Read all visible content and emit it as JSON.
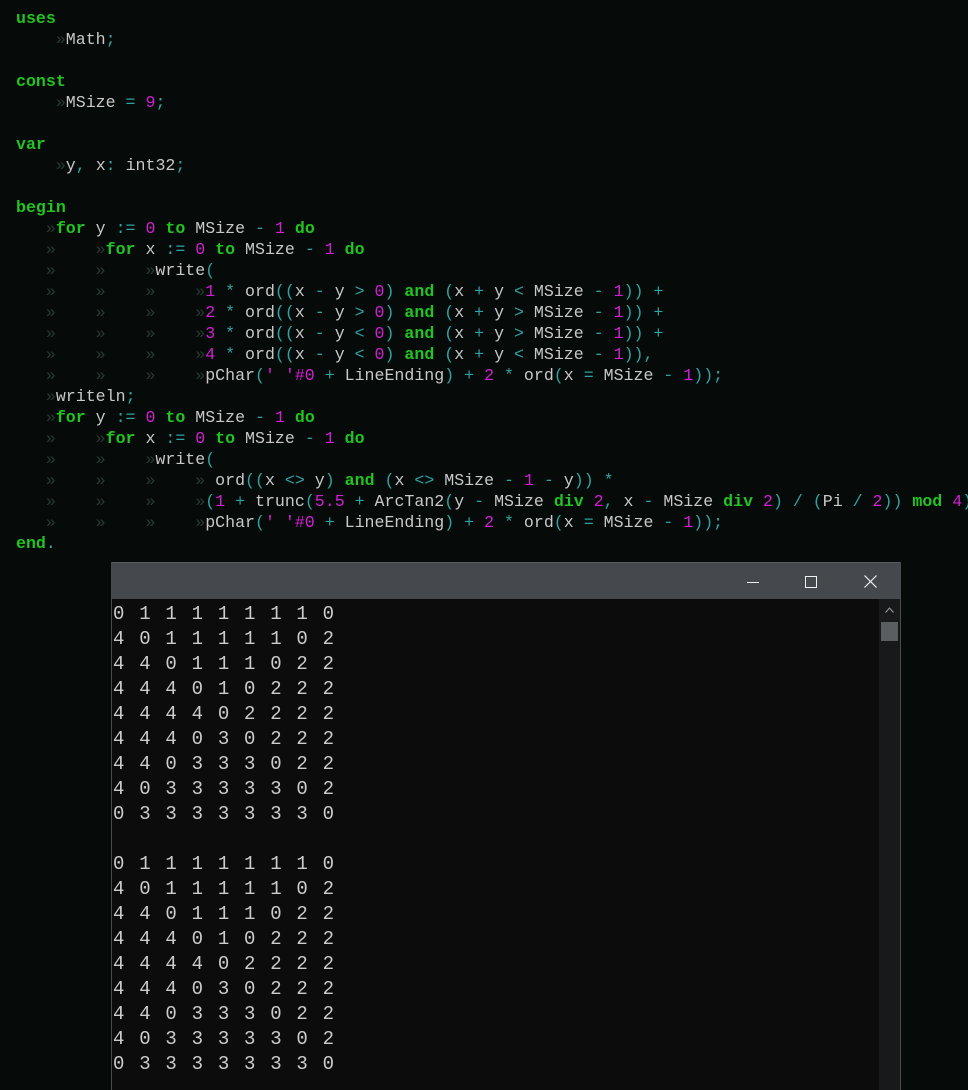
{
  "editor": {
    "lines": [
      [
        [
          "kw",
          "uses"
        ]
      ],
      [
        [
          "ws",
          "    »"
        ],
        [
          "id",
          "Math"
        ],
        [
          "op",
          ";"
        ]
      ],
      [],
      [
        [
          "kw",
          "const"
        ]
      ],
      [
        [
          "ws",
          "    »"
        ],
        [
          "id",
          "MSize"
        ],
        [
          "op",
          " = "
        ],
        [
          "num",
          "9"
        ],
        [
          "op",
          ";"
        ]
      ],
      [],
      [
        [
          "kw",
          "var"
        ]
      ],
      [
        [
          "ws",
          "    »"
        ],
        [
          "id",
          "y"
        ],
        [
          "op",
          ", "
        ],
        [
          "id",
          "x"
        ],
        [
          "op",
          ": "
        ],
        [
          "id",
          "int32"
        ],
        [
          "op",
          ";"
        ]
      ],
      [],
      [
        [
          "kw",
          "begin"
        ]
      ],
      [
        [
          "ws",
          "   »"
        ],
        [
          "kw",
          "for"
        ],
        [
          "id",
          " y "
        ],
        [
          "op",
          ":="
        ],
        [
          "num",
          " 0 "
        ],
        [
          "kw",
          "to"
        ],
        [
          "id",
          " MSize "
        ],
        [
          "op",
          "-"
        ],
        [
          "num",
          " 1 "
        ],
        [
          "kw",
          "do"
        ]
      ],
      [
        [
          "ws",
          "   »    »"
        ],
        [
          "kw",
          "for"
        ],
        [
          "id",
          " x "
        ],
        [
          "op",
          ":="
        ],
        [
          "num",
          " 0 "
        ],
        [
          "kw",
          "to"
        ],
        [
          "id",
          " MSize "
        ],
        [
          "op",
          "-"
        ],
        [
          "num",
          " 1 "
        ],
        [
          "kw",
          "do"
        ]
      ],
      [
        [
          "ws",
          "   »    »    »"
        ],
        [
          "id",
          "write"
        ],
        [
          "op",
          "("
        ]
      ],
      [
        [
          "ws",
          "   »    »    »    »"
        ],
        [
          "num",
          "1"
        ],
        [
          "op",
          " * "
        ],
        [
          "id",
          "ord"
        ],
        [
          "op",
          "(("
        ],
        [
          "id",
          "x "
        ],
        [
          "op",
          "-"
        ],
        [
          "id",
          " y "
        ],
        [
          "op",
          ">"
        ],
        [
          "num",
          " 0"
        ],
        [
          "op",
          ") "
        ],
        [
          "kw",
          "and"
        ],
        [
          "op",
          " ("
        ],
        [
          "id",
          "x "
        ],
        [
          "op",
          "+"
        ],
        [
          "id",
          " y "
        ],
        [
          "op",
          "<"
        ],
        [
          "id",
          " MSize "
        ],
        [
          "op",
          "-"
        ],
        [
          "num",
          " 1"
        ],
        [
          "op",
          ")) +"
        ]
      ],
      [
        [
          "ws",
          "   »    »    »    »"
        ],
        [
          "num",
          "2"
        ],
        [
          "op",
          " * "
        ],
        [
          "id",
          "ord"
        ],
        [
          "op",
          "(("
        ],
        [
          "id",
          "x "
        ],
        [
          "op",
          "-"
        ],
        [
          "id",
          " y "
        ],
        [
          "op",
          ">"
        ],
        [
          "num",
          " 0"
        ],
        [
          "op",
          ") "
        ],
        [
          "kw",
          "and"
        ],
        [
          "op",
          " ("
        ],
        [
          "id",
          "x "
        ],
        [
          "op",
          "+"
        ],
        [
          "id",
          " y "
        ],
        [
          "op",
          ">"
        ],
        [
          "id",
          " MSize "
        ],
        [
          "op",
          "-"
        ],
        [
          "num",
          " 1"
        ],
        [
          "op",
          ")) +"
        ]
      ],
      [
        [
          "ws",
          "   »    »    »    »"
        ],
        [
          "num",
          "3"
        ],
        [
          "op",
          " * "
        ],
        [
          "id",
          "ord"
        ],
        [
          "op",
          "(("
        ],
        [
          "id",
          "x "
        ],
        [
          "op",
          "-"
        ],
        [
          "id",
          " y "
        ],
        [
          "op",
          "<"
        ],
        [
          "num",
          " 0"
        ],
        [
          "op",
          ") "
        ],
        [
          "kw",
          "and"
        ],
        [
          "op",
          " ("
        ],
        [
          "id",
          "x "
        ],
        [
          "op",
          "+"
        ],
        [
          "id",
          " y "
        ],
        [
          "op",
          ">"
        ],
        [
          "id",
          " MSize "
        ],
        [
          "op",
          "-"
        ],
        [
          "num",
          " 1"
        ],
        [
          "op",
          ")) +"
        ]
      ],
      [
        [
          "ws",
          "   »    »    »    »"
        ],
        [
          "num",
          "4"
        ],
        [
          "op",
          " * "
        ],
        [
          "id",
          "ord"
        ],
        [
          "op",
          "(("
        ],
        [
          "id",
          "x "
        ],
        [
          "op",
          "-"
        ],
        [
          "id",
          " y "
        ],
        [
          "op",
          "<"
        ],
        [
          "num",
          " 0"
        ],
        [
          "op",
          ") "
        ],
        [
          "kw",
          "and"
        ],
        [
          "op",
          " ("
        ],
        [
          "id",
          "x "
        ],
        [
          "op",
          "+"
        ],
        [
          "id",
          " y "
        ],
        [
          "op",
          "<"
        ],
        [
          "id",
          " MSize "
        ],
        [
          "op",
          "-"
        ],
        [
          "num",
          " 1"
        ],
        [
          "op",
          ")),"
        ]
      ],
      [
        [
          "ws",
          "   »    »    »    »"
        ],
        [
          "id",
          "pChar"
        ],
        [
          "op",
          "("
        ],
        [
          "str",
          "' '#0"
        ],
        [
          "op",
          " + "
        ],
        [
          "id",
          "LineEnding"
        ],
        [
          "op",
          ") + "
        ],
        [
          "num",
          "2"
        ],
        [
          "op",
          " * "
        ],
        [
          "id",
          "ord"
        ],
        [
          "op",
          "("
        ],
        [
          "id",
          "x "
        ],
        [
          "op",
          "="
        ],
        [
          "id",
          " MSize "
        ],
        [
          "op",
          "-"
        ],
        [
          "num",
          " 1"
        ],
        [
          "op",
          "));"
        ]
      ],
      [
        [
          "ws",
          "   »"
        ],
        [
          "id",
          "writeln"
        ],
        [
          "op",
          ";"
        ]
      ],
      [
        [
          "ws",
          "   »"
        ],
        [
          "kw",
          "for"
        ],
        [
          "id",
          " y "
        ],
        [
          "op",
          ":="
        ],
        [
          "num",
          " 0 "
        ],
        [
          "kw",
          "to"
        ],
        [
          "id",
          " MSize "
        ],
        [
          "op",
          "-"
        ],
        [
          "num",
          " 1 "
        ],
        [
          "kw",
          "do"
        ]
      ],
      [
        [
          "ws",
          "   »    »"
        ],
        [
          "kw",
          "for"
        ],
        [
          "id",
          " x "
        ],
        [
          "op",
          ":="
        ],
        [
          "num",
          " 0 "
        ],
        [
          "kw",
          "to"
        ],
        [
          "id",
          " MSize "
        ],
        [
          "op",
          "-"
        ],
        [
          "num",
          " 1 "
        ],
        [
          "kw",
          "do"
        ]
      ],
      [
        [
          "ws",
          "   »    »    »"
        ],
        [
          "id",
          "write"
        ],
        [
          "op",
          "("
        ]
      ],
      [
        [
          "ws",
          "   »    »    »    » "
        ],
        [
          "id",
          "ord"
        ],
        [
          "op",
          "(("
        ],
        [
          "id",
          "x "
        ],
        [
          "op",
          "<>"
        ],
        [
          "id",
          " y"
        ],
        [
          "op",
          ") "
        ],
        [
          "kw",
          "and"
        ],
        [
          "op",
          " ("
        ],
        [
          "id",
          "x "
        ],
        [
          "op",
          "<>"
        ],
        [
          "id",
          " MSize "
        ],
        [
          "op",
          "-"
        ],
        [
          "num",
          " 1 "
        ],
        [
          "op",
          "-"
        ],
        [
          "id",
          " y"
        ],
        [
          "op",
          ")) *"
        ]
      ],
      [
        [
          "ws",
          "   »    »    »    »"
        ],
        [
          "op",
          "("
        ],
        [
          "num",
          "1"
        ],
        [
          "op",
          " + "
        ],
        [
          "id",
          "trunc"
        ],
        [
          "op",
          "("
        ],
        [
          "num",
          "5.5"
        ],
        [
          "op",
          " + "
        ],
        [
          "id",
          "ArcTan2"
        ],
        [
          "op",
          "("
        ],
        [
          "id",
          "y "
        ],
        [
          "op",
          "-"
        ],
        [
          "id",
          " MSize "
        ],
        [
          "kw",
          "div"
        ],
        [
          "num",
          " 2"
        ],
        [
          "op",
          ", "
        ],
        [
          "id",
          "x "
        ],
        [
          "op",
          "-"
        ],
        [
          "id",
          " MSize "
        ],
        [
          "kw",
          "div"
        ],
        [
          "num",
          " 2"
        ],
        [
          "op",
          ") / ("
        ],
        [
          "id",
          "Pi "
        ],
        [
          "op",
          "/"
        ],
        [
          "num",
          " 2"
        ],
        [
          "op",
          ")) "
        ],
        [
          "kw",
          "mod"
        ],
        [
          "num",
          " 4"
        ],
        [
          "op",
          "),"
        ]
      ],
      [
        [
          "ws",
          "   »    »    »    »"
        ],
        [
          "id",
          "pChar"
        ],
        [
          "op",
          "("
        ],
        [
          "str",
          "' '#0"
        ],
        [
          "op",
          " + "
        ],
        [
          "id",
          "LineEnding"
        ],
        [
          "op",
          ") + "
        ],
        [
          "num",
          "2"
        ],
        [
          "op",
          " * "
        ],
        [
          "id",
          "ord"
        ],
        [
          "op",
          "("
        ],
        [
          "id",
          "x "
        ],
        [
          "op",
          "="
        ],
        [
          "id",
          " MSize "
        ],
        [
          "op",
          "-"
        ],
        [
          "num",
          " 1"
        ],
        [
          "op",
          "));"
        ]
      ],
      [
        [
          "kw",
          "end"
        ],
        [
          "op",
          "."
        ]
      ]
    ]
  },
  "console": {
    "window_controls": {
      "minimize": "minimize-icon",
      "maximize": "maximize-icon",
      "close": "close-icon"
    },
    "output_lines": [
      "0 1 1 1 1 1 1 1 0",
      "4 0 1 1 1 1 1 0 2",
      "4 4 0 1 1 1 0 2 2",
      "4 4 4 0 1 0 2 2 2",
      "4 4 4 4 0 2 2 2 2",
      "4 4 4 0 3 0 2 2 2",
      "4 4 0 3 3 3 0 2 2",
      "4 0 3 3 3 3 3 0 2",
      "0 3 3 3 3 3 3 3 0",
      "",
      "0 1 1 1 1 1 1 1 0",
      "4 0 1 1 1 1 1 0 2",
      "4 4 0 1 1 1 0 2 2",
      "4 4 4 0 1 0 2 2 2",
      "4 4 4 4 0 2 2 2 2",
      "4 4 4 0 3 0 2 2 2",
      "4 4 0 3 3 3 0 2 2",
      "4 0 3 3 3 3 3 0 2",
      "0 3 3 3 3 3 3 3 0"
    ]
  }
}
